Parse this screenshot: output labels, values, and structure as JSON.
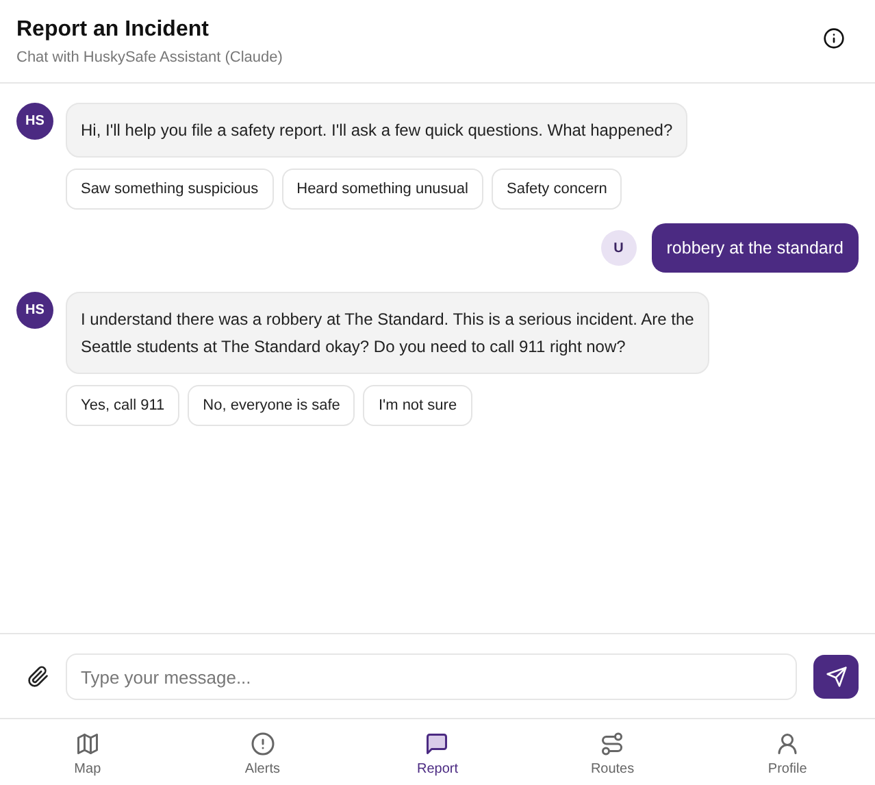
{
  "header": {
    "title": "Report an Incident",
    "subtitle": "Chat with HuskySafe Assistant (Claude)"
  },
  "messages": [
    {
      "kind": "assistant",
      "avatar": "HS",
      "text": "Hi, I'll help you file a safety report. I'll ask a few quick questions. What happened?",
      "quick_replies": [
        "Saw something suspicious",
        "Heard something unusual",
        "Safety concern"
      ]
    },
    {
      "kind": "user",
      "avatar": "U",
      "text": "robbery at the standard"
    },
    {
      "kind": "assistant",
      "avatar": "HS",
      "text": "I understand there was a robbery at The Standard. This is a serious incident. Are the Seattle students at The Standard okay? Do you need to call 911 right now?",
      "quick_replies": [
        "Yes, call 911",
        "No, everyone is safe",
        "I'm not sure"
      ]
    }
  ],
  "composer": {
    "placeholder": "Type your message..."
  },
  "nav": [
    {
      "kind": "map",
      "label": "Map",
      "selected": false
    },
    {
      "kind": "alerts",
      "label": "Alerts",
      "selected": false
    },
    {
      "kind": "report",
      "label": "Report",
      "selected": true
    },
    {
      "kind": "routes",
      "label": "Routes",
      "selected": false
    },
    {
      "kind": "profile",
      "label": "Profile",
      "selected": false
    }
  ]
}
